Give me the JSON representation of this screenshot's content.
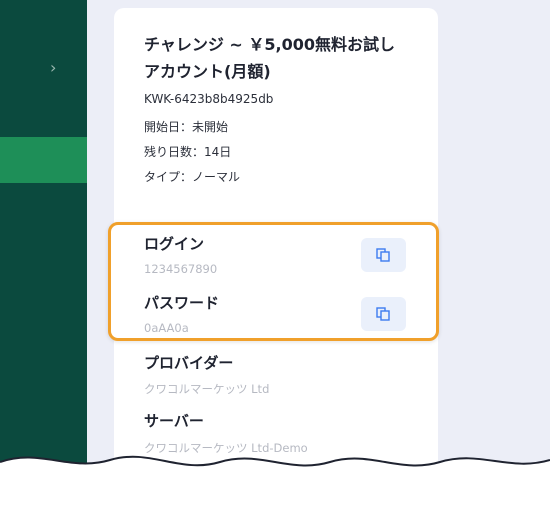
{
  "account": {
    "title": "チャレンジ ~ ￥5,000無料お試しアカウント(月額)",
    "id": "KWK-6423b8b4925db",
    "start_date": "開始日：未開始",
    "days_left": "残り日数：14日",
    "type": "タイプ：ノーマル"
  },
  "credentials": {
    "login_label": "ログイン",
    "login_value": "1234567890",
    "password_label": "パスワード",
    "password_value": "0aAA0a"
  },
  "server_info": {
    "provider_label": "プロバイダー",
    "provider_value": "クワコルマーケッツ Ltd",
    "server_label": "サーバー",
    "server_value": "クワコルマーケッツ Ltd-Demo"
  },
  "icons": {
    "sidebar_toggle": "chevron-right-icon",
    "copy": "copy-icon"
  },
  "colors": {
    "sidebar": "#0b4a3e",
    "sidebar_active": "#1e8f58",
    "highlight": "#f0a02b"
  }
}
